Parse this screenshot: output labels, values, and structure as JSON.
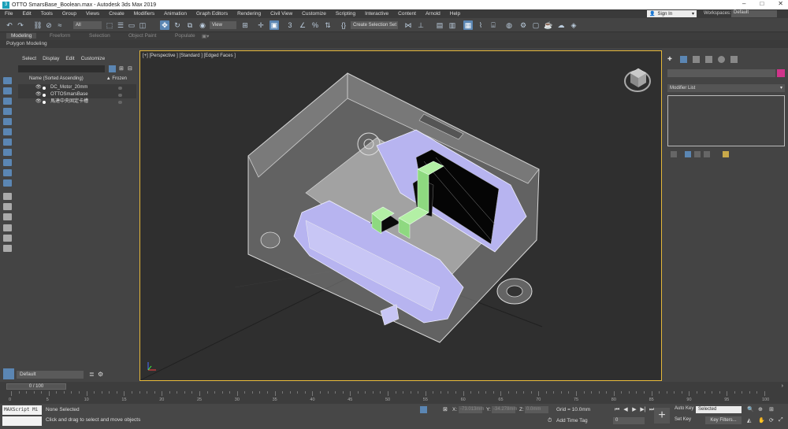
{
  "window": {
    "title": "OTTO SmarsBase_Boolean.max - Autodesk 3ds Max 2019",
    "app_icon": "3ds-max-icon",
    "controls": [
      "minimize-icon",
      "maximize-icon",
      "close-icon"
    ]
  },
  "menu": {
    "items": [
      "File",
      "Edit",
      "Tools",
      "Group",
      "Views",
      "Create",
      "Modifiers",
      "Animation",
      "Graph Editors",
      "Rendering",
      "Civil View",
      "Customize",
      "Scripting",
      "Interactive",
      "Content",
      "Arnold",
      "Help"
    ],
    "sign_in": "Sign In",
    "workspaces_label": "Workspaces:",
    "workspaces_value": "Default"
  },
  "toolbar": {
    "selection_filter": "All",
    "ref_coord": "View",
    "named_selection": "Create Selection Set"
  },
  "ribbon": {
    "tabs": [
      "Modeling",
      "Freeform",
      "Selection",
      "Object Paint",
      "Populate"
    ],
    "active": "Modeling",
    "subbar": "Polygon Modeling"
  },
  "scene_explorer": {
    "tabs": [
      "Select",
      "Display",
      "Edit",
      "Customize"
    ],
    "column_name": "Name (Sorted Ascending)",
    "column_frozen": "▲ Frozen",
    "rows": [
      {
        "name": "DC_Motor_20mm"
      },
      {
        "name": "OTTOSmarsBase"
      },
      {
        "name": "馬達中央固定卡槽"
      }
    ]
  },
  "viewport": {
    "label": "[+] [Perspective ] [Standard ] [Edged Faces ]"
  },
  "command_panel": {
    "modifier_list": "Modifier List",
    "object_color": "#d0348a"
  },
  "layer": {
    "current": "Default"
  },
  "time": {
    "slider": "0 / 100",
    "ticks": [
      "0",
      "5",
      "10",
      "15",
      "20",
      "25",
      "30",
      "35",
      "40",
      "45",
      "50",
      "55",
      "60",
      "65",
      "70",
      "75",
      "80",
      "85",
      "90",
      "95",
      "100"
    ]
  },
  "status": {
    "maxscript": "MAXScript Mi",
    "selection": "None Selected",
    "prompt": "Click and drag to select and move objects",
    "x_label": "X:",
    "y_label": "Y:",
    "z_label": "Z:",
    "x_value": "-73.013mm",
    "y_value": "-34.278mm",
    "z_value": "0.0mm",
    "grid": "Grid = 10.0mm",
    "add_time_tag": "Add Time Tag",
    "auto_key": "Auto Key",
    "set_key": "Set Key",
    "key_mode": "Selected",
    "key_filters": "Key Filters...",
    "frame": "0"
  }
}
